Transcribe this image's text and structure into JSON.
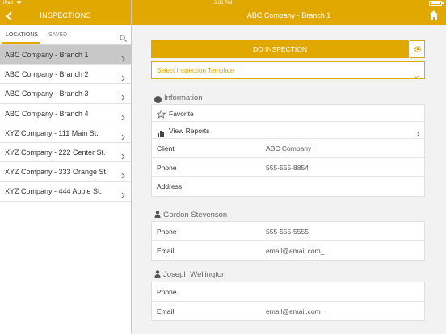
{
  "status_bar": {
    "carrier": "iPad",
    "time": "3:36 PM"
  },
  "left_nav": {
    "title": "INSPECTIONS"
  },
  "right_nav": {
    "title": "ABC Company - Branch 1"
  },
  "tabs": {
    "locations": "LOCATIONS",
    "saved": "SAVED"
  },
  "locations": [
    {
      "label": "ABC Company - Branch 1",
      "selected": true
    },
    {
      "label": "ABC Company - Branch 2",
      "selected": false
    },
    {
      "label": "ABC Company - Branch 3",
      "selected": false
    },
    {
      "label": "ABC Company - Branch 4",
      "selected": false
    },
    {
      "label": "XYZ Company - 111 Main St.",
      "selected": false
    },
    {
      "label": "XYZ Company - 222 Center St.",
      "selected": false
    },
    {
      "label": "XYZ Company - 333 Orange St.",
      "selected": false
    },
    {
      "label": "XYZ Company - 444 Apple St.",
      "selected": false
    }
  ],
  "main": {
    "do_inspection_label": "DO INSPECTION",
    "template_placeholder": "Select Inspection Template",
    "information": {
      "heading": "Information",
      "favorite_label": "Favorite",
      "view_reports_label": "View Reports",
      "client_label": "Client",
      "client_value": "ABC Company",
      "phone_label": "Phone",
      "phone_value": "555-555-8854",
      "address_label": "Address",
      "address_value": ""
    },
    "contacts": [
      {
        "name": "Gordon Stevenson",
        "phone_label": "Phone",
        "phone_value": "555-555-5555",
        "email_label": "Email",
        "email_value": "email@email.com_"
      },
      {
        "name": "Joseph Wellington",
        "phone_label": "Phone",
        "phone_value": "",
        "email_label": "Email",
        "email_value": "email@email.com_"
      }
    ]
  },
  "colors": {
    "accent": "#e0a800",
    "selected_row": "#c8c8c8",
    "content_bg": "#f2f2f2"
  },
  "icons": [
    "back-icon",
    "home-icon",
    "search-icon",
    "gear-icon",
    "info-icon",
    "star-icon",
    "bar-chart-icon",
    "person-icon",
    "chevron-right-icon",
    "chevron-down-icon"
  ]
}
